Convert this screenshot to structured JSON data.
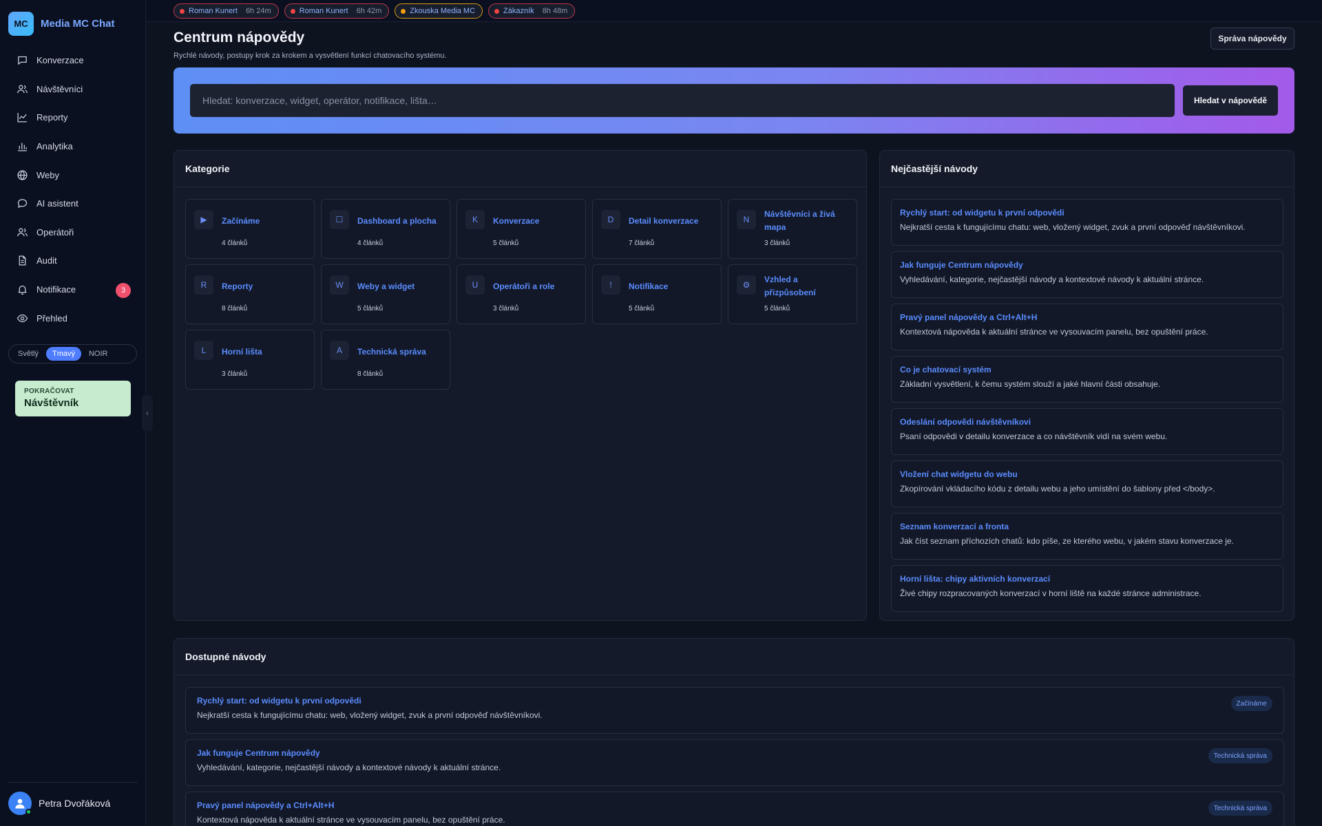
{
  "app": {
    "logo_text": "MC",
    "name": "Media MC Chat"
  },
  "sidebar": {
    "items": [
      {
        "label": "Konverzace",
        "icon": "chat-bubble-icon"
      },
      {
        "label": "Návštěvníci",
        "icon": "users-icon"
      },
      {
        "label": "Reporty",
        "icon": "line-chart-icon"
      },
      {
        "label": "Analytika",
        "icon": "bar-chart-icon"
      },
      {
        "label": "Weby",
        "icon": "globe-icon"
      },
      {
        "label": "AI asistent",
        "icon": "chat-bubble-icon"
      },
      {
        "label": "Operátoři",
        "icon": "users-icon"
      },
      {
        "label": "Audit",
        "icon": "document-icon"
      },
      {
        "label": "Notifikace",
        "icon": "bell-icon",
        "badge": "3"
      },
      {
        "label": "Přehled",
        "icon": "eye-icon"
      }
    ],
    "theme": {
      "options": [
        "Světlý",
        "Tmavý",
        "NOIR"
      ],
      "active": "Tmavý"
    },
    "continue": {
      "kicker": "POKRAČOVAT",
      "value": "Návštěvník"
    },
    "collapse_glyph": "‹",
    "user": {
      "name": "Petra Dvořáková"
    }
  },
  "chips": [
    {
      "name": "Roman Kunert",
      "time": "6h 24m",
      "status": "red"
    },
    {
      "name": "Roman Kunert",
      "time": "6h 42m",
      "status": "red"
    },
    {
      "name": "Zkouska Media MC",
      "time": "",
      "status": "orange"
    },
    {
      "name": "Zákazník",
      "time": "8h 48m",
      "status": "red"
    }
  ],
  "header": {
    "title": "Centrum nápovědy",
    "subtitle": "Rychlé návody, postupy krok za krokem a vysvětlení funkcí chatovacího systému.",
    "manage_label": "Správa nápovědy"
  },
  "search": {
    "placeholder": "Hledat: konverzace, widget, operátor, notifikace, lišta…",
    "button_label": "Hledat v nápovědě"
  },
  "categories": {
    "title": "Kategorie",
    "items": [
      {
        "letter": "▶",
        "name": "Začínáme",
        "count": "4 článků"
      },
      {
        "letter": "☐",
        "name": "Dashboard a plocha",
        "count": "4 článků"
      },
      {
        "letter": "K",
        "name": "Konverzace",
        "count": "5 článků"
      },
      {
        "letter": "D",
        "name": "Detail konverzace",
        "count": "7 článků"
      },
      {
        "letter": "N",
        "name": "Návštěvníci a živá mapa",
        "count": "3 článků"
      },
      {
        "letter": "R",
        "name": "Reporty",
        "count": "8 článků"
      },
      {
        "letter": "W",
        "name": "Weby a widget",
        "count": "5 článků"
      },
      {
        "letter": "U",
        "name": "Operátoři a role",
        "count": "3 článků"
      },
      {
        "letter": "!",
        "name": "Notifikace",
        "count": "5 článků"
      },
      {
        "letter": "⚙",
        "name": "Vzhled a přizpůsobení",
        "count": "5 článků"
      },
      {
        "letter": "L",
        "name": "Horní lišta",
        "count": "3 článků"
      },
      {
        "letter": "A",
        "name": "Technická správa",
        "count": "8 článků"
      }
    ]
  },
  "popular": {
    "title": "Nejčastější návody",
    "items": [
      {
        "title": "Rychlý start: od widgetu k první odpovědi",
        "desc": "Nejkratší cesta k fungujícímu chatu: web, vložený widget, zvuk a první odpověď návštěvníkovi."
      },
      {
        "title": "Jak funguje Centrum nápovědy",
        "desc": "Vyhledávání, kategorie, nejčastější návody a kontextové návody k aktuální stránce."
      },
      {
        "title": "Pravý panel nápovědy a Ctrl+Alt+H",
        "desc": "Kontextová nápověda k aktuální stránce ve vysouvacím panelu, bez opuštění práce."
      },
      {
        "title": "Co je chatovací systém",
        "desc": "Základní vysvětlení, k čemu systém slouží a jaké hlavní části obsahuje."
      },
      {
        "title": "Odeslání odpovědi návštěvníkovi",
        "desc": "Psaní odpovědi v detailu konverzace a co návštěvník vidí na svém webu."
      },
      {
        "title": "Vložení chat widgetu do webu",
        "desc": "Zkopírování vkládacího kódu z detailu webu a jeho umístění do šablony před </body>."
      },
      {
        "title": "Seznam konverzací a fronta",
        "desc": "Jak číst seznam příchozích chatů: kdo píše, ze kterého webu, v jakém stavu konverzace je."
      },
      {
        "title": "Horní lišta: chipy aktivních konverzací",
        "desc": "Živé chipy rozpracovaných konverzací v horní liště na každé stránce administrace."
      }
    ]
  },
  "available": {
    "title": "Dostupné návody",
    "items": [
      {
        "title": "Rychlý start: od widgetu k první odpovědi",
        "desc": "Nejkratší cesta k fungujícímu chatu: web, vložený widget, zvuk a první odpověď návštěvníkovi.",
        "tag": "Začínáme"
      },
      {
        "title": "Jak funguje Centrum nápovědy",
        "desc": "Vyhledávání, kategorie, nejčastější návody a kontextové návody k aktuální stránce.",
        "tag": "Technická správa"
      },
      {
        "title": "Pravý panel nápovědy a Ctrl+Alt+H",
        "desc": "Kontextová nápověda k aktuální stránce ve vysouvacím panelu, bez opuštění práce.",
        "tag": "Technická správa"
      }
    ]
  },
  "colors": {
    "accent": "#5b8cff",
    "background": "#0e1320",
    "panel": "#141a29",
    "danger": "#ef4444",
    "warning": "#f59e0b",
    "continue_card": "#c7ebcf"
  }
}
